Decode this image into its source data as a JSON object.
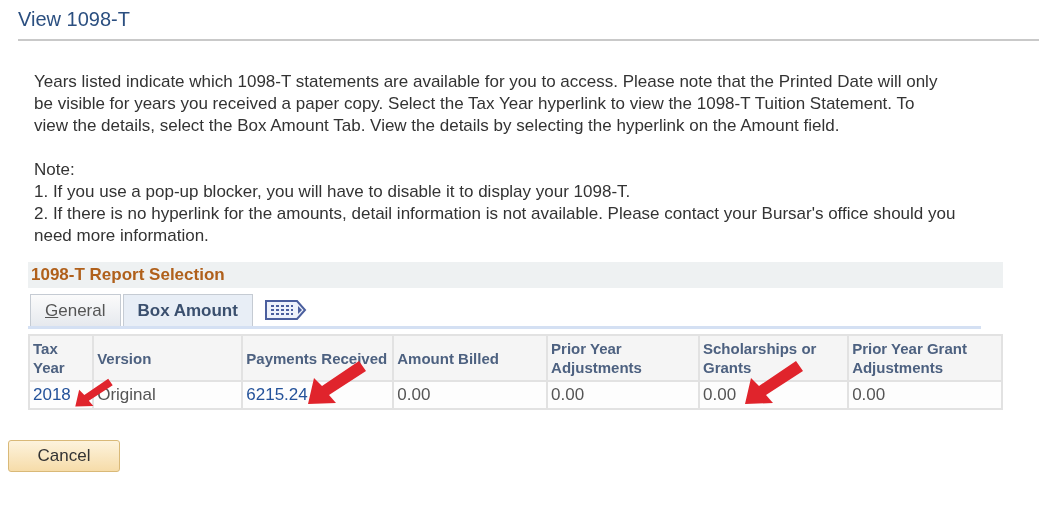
{
  "page_title": "View 1098-T",
  "intro": "Years listed indicate which 1098-T statements are available for you to access.  Please note that the Printed Date will only be visible for years you received a paper copy.  Select the Tax Year hyperlink to view the 1098-T Tuition Statement.  To view the details, select the Box Amount Tab.  View the details by selecting the hyperlink on the Amount field.",
  "note_heading": "Note:",
  "notes": [
    "1.  If you use a pop-up blocker, you will have to disable it to display your 1098-T.",
    "2.  If there is no hyperlink for the amounts, detail information is not available.  Please contact your Bursar's office should you need more information."
  ],
  "section_title": "1098-T Report Selection",
  "tabs": [
    {
      "label": "General",
      "selected": false
    },
    {
      "label": "Box Amount",
      "selected": true
    }
  ],
  "columns": [
    "Tax Year",
    "Version",
    "Payments Received",
    "Amount Billed",
    "Prior Year Adjustments",
    "Scholarships or Grants",
    "Prior Year Grant Adjustments"
  ],
  "rows": [
    [
      {
        "text": "2018",
        "kind": "link"
      },
      {
        "text": "Original",
        "kind": "text"
      },
      {
        "text": "6215.24",
        "kind": "link"
      },
      {
        "text": "0.00",
        "kind": "text"
      },
      {
        "text": "0.00",
        "kind": "text"
      },
      {
        "text": "0.00",
        "kind": "text"
      },
      {
        "text": "0.00",
        "kind": "text"
      }
    ]
  ],
  "cancel_button": "Cancel"
}
